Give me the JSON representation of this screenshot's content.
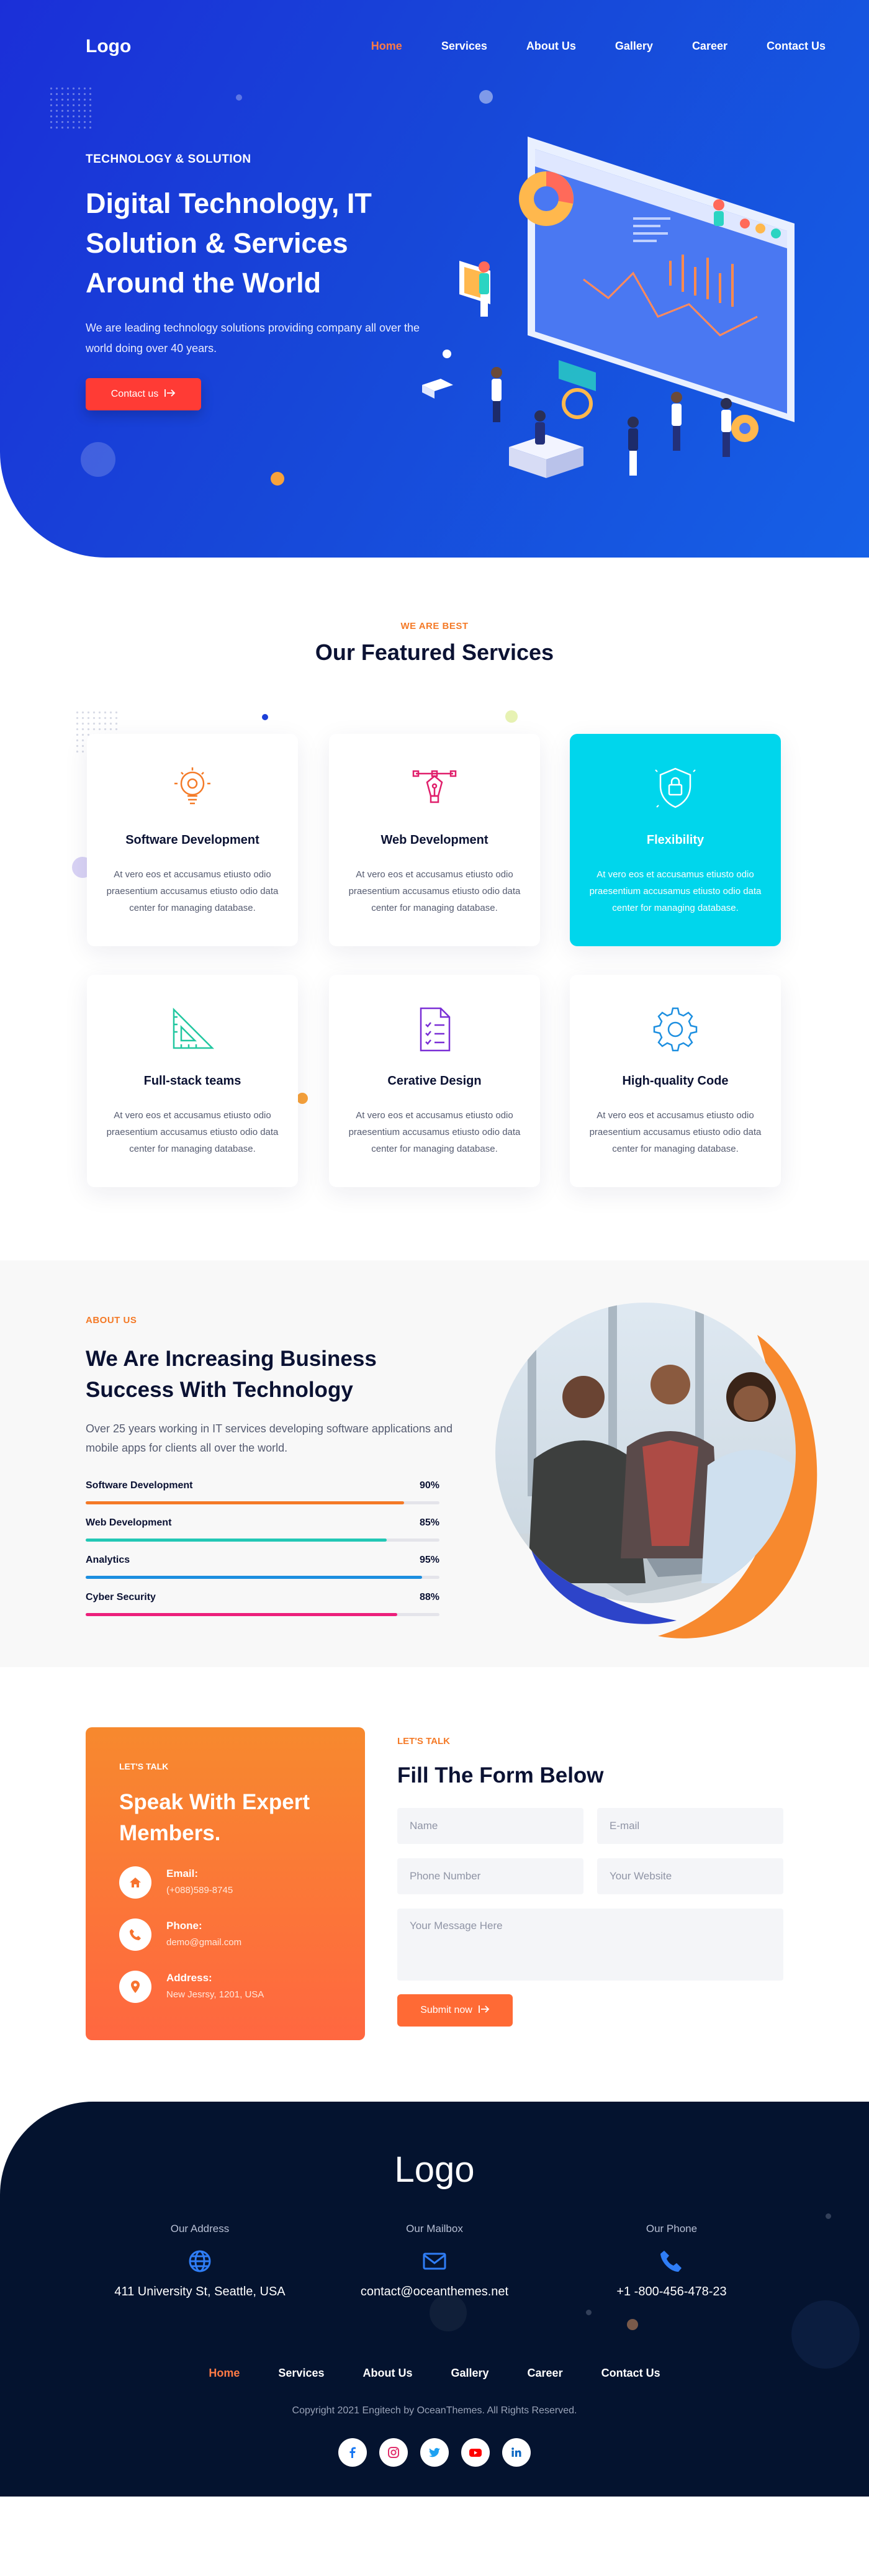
{
  "nav": {
    "logo": "Logo",
    "items": [
      "Home",
      "Services",
      "About Us",
      "Gallery",
      "Career",
      "Contact Us"
    ]
  },
  "hero": {
    "kicker": "TECHNOLOGY & SOLUTION",
    "title": "Digital Technology, IT Solution & Services Around the World",
    "description": "We are leading technology solutions providing company all over the world doing over 40 years.",
    "cta": "Contact us",
    "cta_icon": "arrow-right-icon"
  },
  "services": {
    "kicker": "WE ARE BEST",
    "title": "Our Featured Services",
    "cards": [
      {
        "title": "Software Development",
        "text": "At vero eos et accusamus etiusto odio praesentium accusamus etiusto odio data center for managing database.",
        "icon": "lightbulb-gear-icon"
      },
      {
        "title": "Web Development",
        "text": "At vero eos et accusamus etiusto odio praesentium accusamus etiusto odio data center for managing database.",
        "icon": "pen-tool-icon"
      },
      {
        "title": "Flexibility",
        "text": "At vero eos et accusamus etiusto odio praesentium accusamus etiusto odio data center for managing database.",
        "icon": "shield-lock-icon"
      },
      {
        "title": "Full-stack teams",
        "text": "At vero eos et accusamus etiusto odio praesentium accusamus etiusto odio data center for managing database.",
        "icon": "set-square-icon"
      },
      {
        "title": "Cerative Design",
        "text": "At vero eos et accusamus etiusto odio praesentium accusamus etiusto odio data center for managing database.",
        "icon": "checklist-document-icon"
      },
      {
        "title": "High-quality Code",
        "text": "At vero eos et accusamus etiusto odio praesentium accusamus etiusto odio data center for managing database.",
        "icon": "gear-icon"
      }
    ]
  },
  "about": {
    "kicker": "ABOUT US",
    "title": "We Are Increasing Business Success With Technology",
    "description": "Over 25 years working in IT services developing software applications and mobile apps for clients all over the world.",
    "skills": [
      {
        "name": "Software Development",
        "percent": "90%",
        "value": 0.9,
        "color": "#f47a27"
      },
      {
        "name": "Web Development",
        "percent": "85%",
        "value": 0.85,
        "color": "#22c7b5"
      },
      {
        "name": "Analytics",
        "percent": "95%",
        "value": 0.95,
        "color": "#1d8fe0"
      },
      {
        "name": "Cyber Security",
        "percent": "88%",
        "value": 0.88,
        "color": "#ec1f7b"
      }
    ]
  },
  "contact": {
    "kicker": "LET'S TALK",
    "title": "Speak With Expert Members.",
    "items": [
      {
        "label": "Email:",
        "value": "(+088)589-8745",
        "icon": "home-icon"
      },
      {
        "label": "Phone:",
        "value": "demo@gmail.com",
        "icon": "phone-icon"
      },
      {
        "label": "Address:",
        "value": "New Jesrsy, 1201, USA",
        "icon": "location-pin-icon"
      }
    ]
  },
  "form": {
    "kicker": "LET'S TALK",
    "title": "Fill The Form Below",
    "name_placeholder": "Name",
    "email_placeholder": "E-mail",
    "phone_placeholder": "Phone Number",
    "website_placeholder": "Your Website",
    "message_placeholder": "Your Message Here",
    "submit": "Submit now"
  },
  "footer": {
    "logo": "Logo",
    "columns": [
      {
        "label": "Our Address",
        "value": "411 University St, Seattle, USA",
        "icon": "globe-icon"
      },
      {
        "label": "Our Mailbox",
        "value": "contact@oceanthemes.net",
        "icon": "envelope-icon"
      },
      {
        "label": "Our Phone",
        "value": "+1 -800-456-478-23",
        "icon": "phone-icon"
      }
    ],
    "menu": [
      "Home",
      "Services",
      "About Us",
      "Gallery",
      "Career",
      "Contact Us"
    ],
    "copyright": "Copyright 2021 Engitech by OceanThemes. All Rights Reserved.",
    "social": [
      "facebook-icon",
      "instagram-icon",
      "twitter-icon",
      "youtube-icon",
      "linkedin-icon"
    ]
  },
  "colors": {
    "accent_orange": "#f47a27",
    "hero_blue": "#1747d8",
    "highlight_cyan": "#00d6ec",
    "footer_navy": "#04132f",
    "cta_red": "#ff3b35"
  }
}
